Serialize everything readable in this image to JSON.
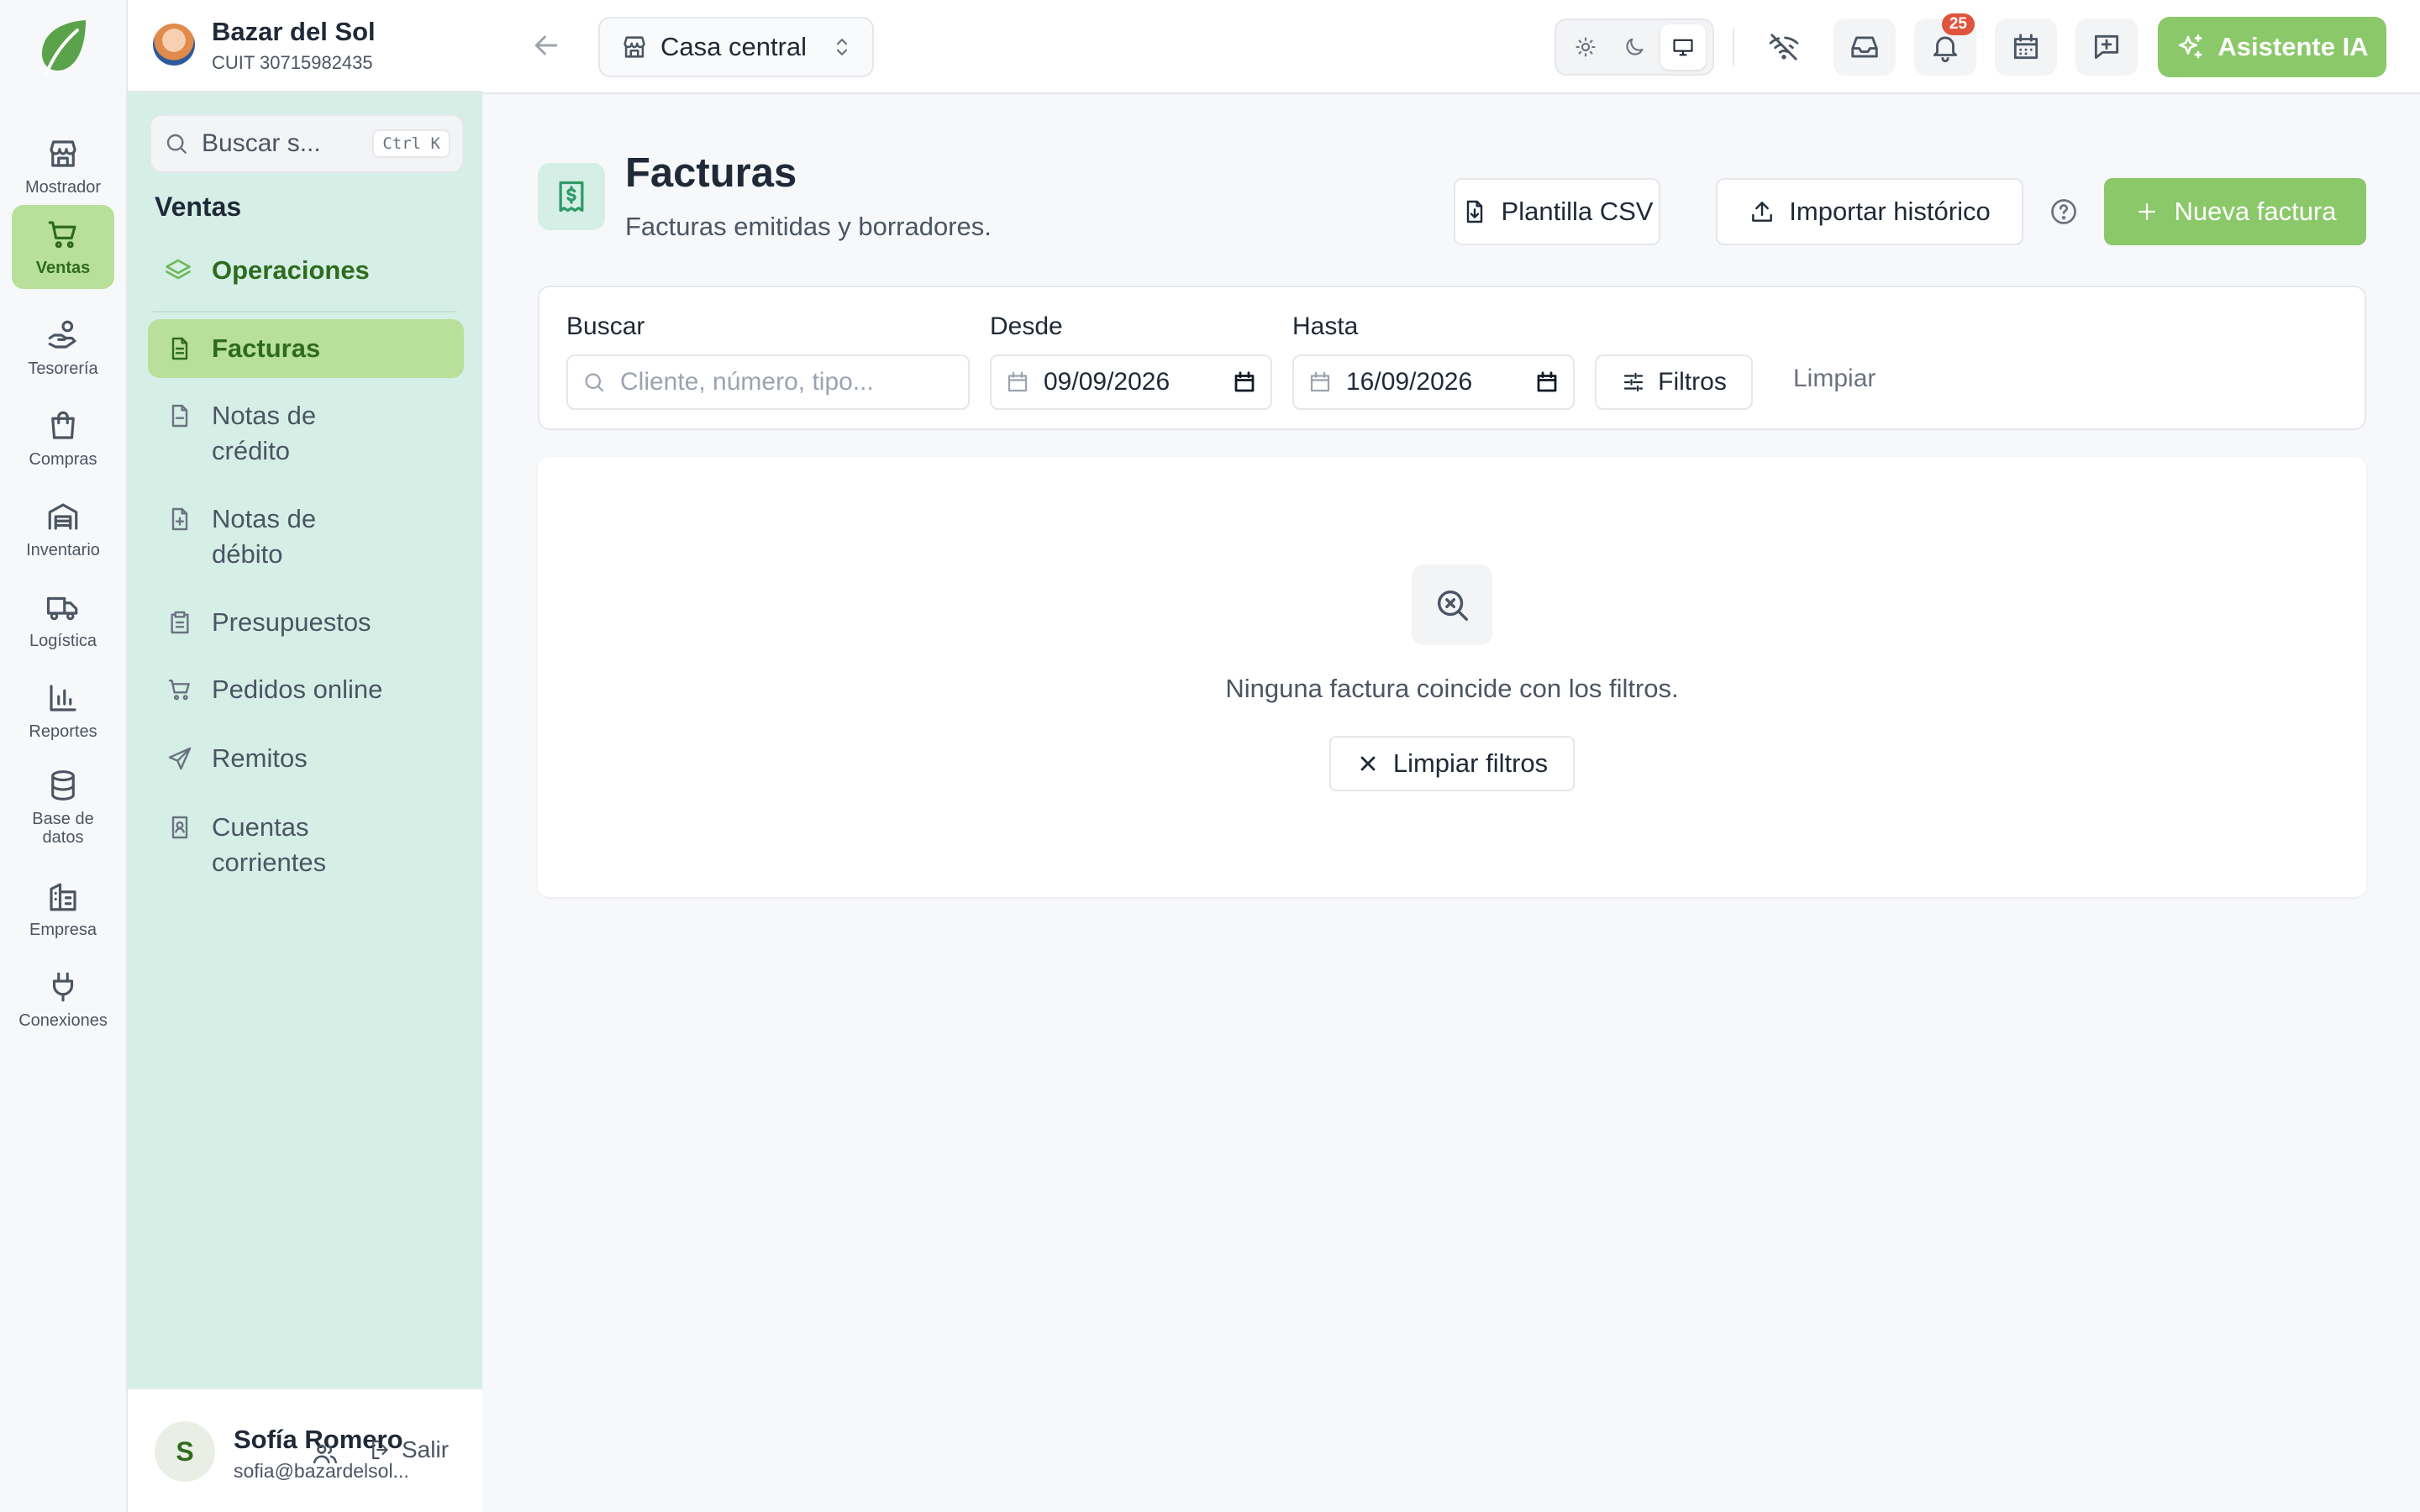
{
  "rail": {
    "items": [
      {
        "label": "Mostrador",
        "icon": "store-icon"
      },
      {
        "label": "Ventas",
        "icon": "cart-icon"
      },
      {
        "label": "Tesorería",
        "icon": "hand-coins-icon"
      },
      {
        "label": "Compras",
        "icon": "shopping-bag-icon"
      },
      {
        "label": "Inventario",
        "icon": "warehouse-icon"
      },
      {
        "label": "Logística",
        "icon": "truck-icon"
      },
      {
        "label": "Reportes",
        "icon": "bar-chart-icon"
      },
      {
        "label": "Base de\ndatos",
        "icon": "database-icon"
      },
      {
        "label": "Empresa",
        "icon": "building-icon"
      },
      {
        "label": "Conexiones",
        "icon": "plug-icon"
      }
    ]
  },
  "sidebar": {
    "company_name": "Bazar del Sol",
    "company_cuit": "CUIT 30715982435",
    "search_label": "Buscar s...",
    "search_shortcut": "Ctrl K",
    "section_title": "Ventas",
    "operations_label": "Operaciones",
    "items": [
      {
        "label": "Facturas",
        "icon": "file-text-icon"
      },
      {
        "label": "Notas de\ncrédito",
        "icon": "file-minus-icon"
      },
      {
        "label": "Notas de\ndébito",
        "icon": "file-plus-icon"
      },
      {
        "label": "Presupuestos",
        "icon": "clipboard-list-icon"
      },
      {
        "label": "Pedidos online",
        "icon": "cart-icon"
      },
      {
        "label": "Remitos",
        "icon": "send-icon"
      },
      {
        "label": "Cuentas\ncorrientes",
        "icon": "contact-book-icon"
      }
    ],
    "user": {
      "initial": "S",
      "name": "Sofía Romero",
      "email": "sofia@bazardelsol...",
      "logout_label": "Salir"
    }
  },
  "topbar": {
    "location": "Casa central",
    "notifications_count": "25",
    "assistant_label": "Asistente IA"
  },
  "page": {
    "title": "Facturas",
    "subtitle": "Facturas emitidas y borradores.",
    "csv_template_label": "Plantilla CSV",
    "import_label": "Importar histórico",
    "new_invoice_label": "Nueva factura"
  },
  "filters": {
    "search_label": "Buscar",
    "search_placeholder": "Cliente, número, tipo...",
    "from_label": "Desde",
    "from_value": "09/09/2026",
    "to_label": "Hasta",
    "to_value": "16/09/2026",
    "filters_button": "Filtros",
    "clear_label": "Limpiar"
  },
  "empty_state": {
    "message": "Ninguna factura coincide con los filtros.",
    "clear_filters_label": "Limpiar filtros"
  },
  "colors": {
    "accent": "#8bc86a",
    "active_bg": "#b8e09a",
    "sidebar_bg": "#d5efe6",
    "badge": "#e0533d"
  }
}
